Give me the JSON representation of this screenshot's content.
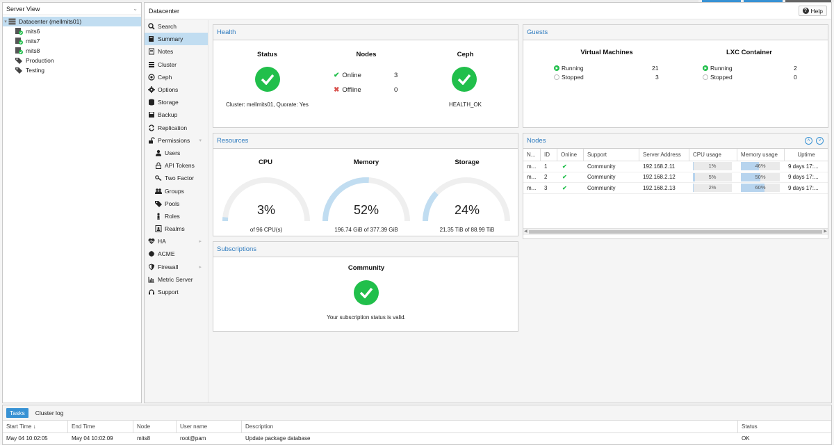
{
  "tree": {
    "view_label": "Server View",
    "items": [
      {
        "label": "Datacenter (mellmits01)",
        "icon": "server-rack-icon"
      },
      {
        "label": "mits6",
        "icon": "node-online-icon"
      },
      {
        "label": "mits7",
        "icon": "node-online-icon"
      },
      {
        "label": "mits8",
        "icon": "node-online-icon"
      },
      {
        "label": "Production",
        "icon": "tags-icon"
      },
      {
        "label": "Testing",
        "icon": "tags-icon"
      }
    ]
  },
  "main": {
    "title": "Datacenter",
    "help_label": "Help"
  },
  "nav": [
    {
      "label": "Search",
      "icon": "search-icon"
    },
    {
      "label": "Summary",
      "icon": "book-icon"
    },
    {
      "label": "Notes",
      "icon": "notes-icon"
    },
    {
      "label": "Cluster",
      "icon": "cluster-icon"
    },
    {
      "label": "Ceph",
      "icon": "ceph-icon"
    },
    {
      "label": "Options",
      "icon": "gear-icon"
    },
    {
      "label": "Storage",
      "icon": "database-icon"
    },
    {
      "label": "Backup",
      "icon": "floppy-icon"
    },
    {
      "label": "Replication",
      "icon": "replication-icon"
    },
    {
      "label": "Permissions",
      "icon": "unlock-icon"
    },
    {
      "label": "Users",
      "icon": "user-icon"
    },
    {
      "label": "API Tokens",
      "icon": "lock-icon"
    },
    {
      "label": "Two Factor",
      "icon": "key-icon"
    },
    {
      "label": "Groups",
      "icon": "users-icon"
    },
    {
      "label": "Pools",
      "icon": "tags-icon"
    },
    {
      "label": "Roles",
      "icon": "person-icon"
    },
    {
      "label": "Realms",
      "icon": "address-book-icon"
    },
    {
      "label": "HA",
      "icon": "heartbeat-icon"
    },
    {
      "label": "ACME",
      "icon": "certificate-icon"
    },
    {
      "label": "Firewall",
      "icon": "shield-icon"
    },
    {
      "label": "Metric Server",
      "icon": "chart-icon"
    },
    {
      "label": "Support",
      "icon": "support-icon"
    }
  ],
  "health": {
    "title": "Health",
    "status_title": "Status",
    "status_text": "Cluster: mellmits01, Quorate: Yes",
    "nodes_title": "Nodes",
    "online_label": "Online",
    "online_count": "3",
    "offline_label": "Offline",
    "offline_count": "0",
    "ceph_title": "Ceph",
    "ceph_text": "HEALTH_OK"
  },
  "guests": {
    "title": "Guests",
    "vm_title": "Virtual Machines",
    "vm_running_label": "Running",
    "vm_running": "21",
    "vm_stopped_label": "Stopped",
    "vm_stopped": "3",
    "lxc_title": "LXC Container",
    "lxc_running_label": "Running",
    "lxc_running": "2",
    "lxc_stopped_label": "Stopped",
    "lxc_stopped": "0"
  },
  "resources": {
    "title": "Resources",
    "cpu_title": "CPU",
    "cpu_value": "3%",
    "cpu_fraction": 0.03,
    "cpu_text": "of 96 CPU(s)",
    "mem_title": "Memory",
    "mem_value": "52%",
    "mem_fraction": 0.52,
    "mem_text": "196.74 GiB of 377.39 GiB",
    "storage_title": "Storage",
    "storage_value": "24%",
    "storage_fraction": 0.24,
    "storage_text": "21.35 TiB of 88.99 TiB"
  },
  "nodes_grid": {
    "title": "Nodes",
    "headers": [
      "N...",
      "ID",
      "Online",
      "Support",
      "Server Address",
      "CPU usage",
      "Memory usage",
      "Uptime"
    ],
    "rows": [
      {
        "name": "m...",
        "id": "1",
        "support": "Community",
        "address": "192.168.2.11",
        "cpu": "1%",
        "cpu_frac": 0.01,
        "mem": "46%",
        "mem_frac": 0.46,
        "uptime": "9 days 17:..."
      },
      {
        "name": "m...",
        "id": "2",
        "support": "Community",
        "address": "192.168.2.12",
        "cpu": "5%",
        "cpu_frac": 0.05,
        "mem": "50%",
        "mem_frac": 0.5,
        "uptime": "9 days 17:..."
      },
      {
        "name": "m...",
        "id": "3",
        "support": "Community",
        "address": "192.168.2.13",
        "cpu": "2%",
        "cpu_frac": 0.02,
        "mem": "60%",
        "mem_frac": 0.6,
        "uptime": "9 days 17:..."
      }
    ]
  },
  "subscriptions": {
    "title": "Subscriptions",
    "level_title": "Community",
    "status_text": "Your subscription status is valid."
  },
  "tasks": {
    "tab_tasks": "Tasks",
    "tab_cluster_log": "Cluster log",
    "headers": [
      "Start Time ↓",
      "End Time",
      "Node",
      "User name",
      "Description",
      "Status"
    ],
    "rows": [
      {
        "start": "May 04 10:02:05",
        "end": "May 04 10:02:09",
        "node": "mits8",
        "user": "root@pam",
        "desc": "Update package database",
        "status": "OK"
      }
    ]
  },
  "colors": {
    "accent": "#2e7bbf",
    "ok_green": "#21bf4b",
    "error_red": "#d9534f",
    "selection": "#c1ddf1"
  }
}
